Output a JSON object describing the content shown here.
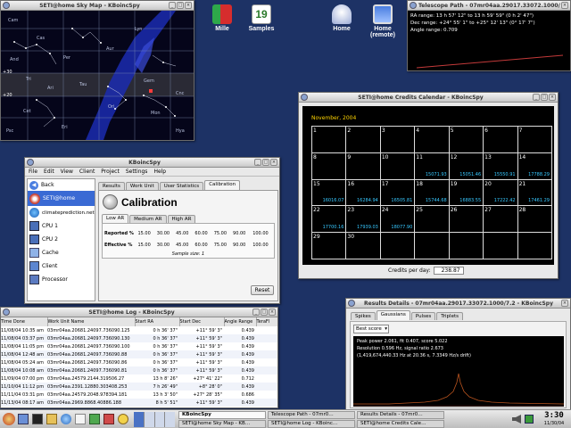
{
  "desktop_icons": [
    {
      "label": "Mille",
      "icon": "seti-flag-icon"
    },
    {
      "label": "Samples",
      "icon": "calendar-icon"
    },
    {
      "label": "Home",
      "icon": "home-dome-icon"
    },
    {
      "label": "Home\n(remote)",
      "icon": "monitor-icon"
    }
  ],
  "sky_map": {
    "title": "SETI@home Sky Map - KBoincSpy",
    "constellations": [
      "Cam",
      "Cas",
      "And",
      "Per",
      "Aur",
      "Lyn",
      "Tri",
      "Ari",
      "Tau",
      "Gem",
      "Ori",
      "Mon",
      "Cet",
      "Eri",
      "Hya",
      "Psc",
      "Cnc"
    ],
    "axis_labels": [
      "+30",
      "+20"
    ]
  },
  "telescope_path": {
    "title": "Telescope Path - 07mr04aa.29017.33072.1000/7.2…",
    "ra_range": "RA range: 13 h 57' 12\" to 13 h 59' 59\" (0 h 2' 47\")",
    "dec_range": "Dec range: +24° 55' 1\" to +25° 12' 13\" (0° 17' 7\")",
    "angle_range": "Angle range: 0.709"
  },
  "credits_calendar": {
    "title": "SETI@home Credits Calendar - KBoincSpy",
    "month": "November, 2004",
    "cells": [
      {
        "day": "1",
        "value": ""
      },
      {
        "day": "2",
        "value": ""
      },
      {
        "day": "3",
        "value": ""
      },
      {
        "day": "4",
        "value": ""
      },
      {
        "day": "5",
        "value": ""
      },
      {
        "day": "6",
        "value": ""
      },
      {
        "day": "7",
        "value": ""
      },
      {
        "day": "8",
        "value": ""
      },
      {
        "day": "9",
        "value": ""
      },
      {
        "day": "10",
        "value": ""
      },
      {
        "day": "11",
        "value": "15071.93"
      },
      {
        "day": "12",
        "value": "15051.46"
      },
      {
        "day": "13",
        "value": "15550.91"
      },
      {
        "day": "14",
        "value": "17788.29"
      },
      {
        "day": "15",
        "value": "16016.07"
      },
      {
        "day": "16",
        "value": "16284.94"
      },
      {
        "day": "17",
        "value": "16505.81"
      },
      {
        "day": "18",
        "value": "15744.68"
      },
      {
        "day": "19",
        "value": "16883.55"
      },
      {
        "day": "20",
        "value": "17222.42"
      },
      {
        "day": "21",
        "value": "17461.29"
      },
      {
        "day": "22",
        "value": "17700.16"
      },
      {
        "day": "23",
        "value": "17939.03"
      },
      {
        "day": "24",
        "value": "18077.90"
      },
      {
        "day": "25",
        "value": ""
      },
      {
        "day": "26",
        "value": ""
      },
      {
        "day": "27",
        "value": ""
      },
      {
        "day": "28",
        "value": ""
      },
      {
        "day": "29",
        "value": ""
      },
      {
        "day": "30",
        "value": ""
      },
      {
        "day": "",
        "value": ""
      },
      {
        "day": "",
        "value": ""
      },
      {
        "day": "",
        "value": ""
      },
      {
        "day": "",
        "value": ""
      },
      {
        "day": "",
        "value": ""
      }
    ],
    "credits_label": "Credits per day:",
    "credits_value": "238.87"
  },
  "kboincspy": {
    "title": "KBoincSpy",
    "menu": [
      "File",
      "Edit",
      "View",
      "Client",
      "Project",
      "Settings",
      "Help"
    ],
    "sidebar": [
      {
        "label": "Back",
        "icon": "back-arrow-icon"
      },
      {
        "label": "SETI@home",
        "icon": "seti-icon"
      },
      {
        "label": "climateprediction.net",
        "icon": "globe-icon"
      },
      {
        "label": "CPU 1",
        "icon": "cpu-icon"
      },
      {
        "label": "CPU 2",
        "icon": "cpu-icon"
      },
      {
        "label": "Cache",
        "icon": "cache-icon"
      },
      {
        "label": "Client",
        "icon": "client-icon"
      },
      {
        "label": "Processor",
        "icon": "processor-icon"
      }
    ],
    "tabs": [
      "Results",
      "Work Unit",
      "User Statistics",
      "Calibration"
    ],
    "heading": "Calibration",
    "sub_tabs": [
      "Low AR",
      "Medium AR",
      "High AR"
    ],
    "rows": [
      {
        "label": "Reported %",
        "values": [
          "15.00",
          "30.00",
          "45.00",
          "60.00",
          "75.00",
          "90.00",
          "100.00"
        ]
      },
      {
        "label": "Effective %",
        "values": [
          "15.00",
          "30.00",
          "45.00",
          "60.00",
          "75.00",
          "90.00",
          "100.00"
        ]
      }
    ],
    "sample_size": "Sample size:  1",
    "reset_label": "Reset"
  },
  "work_log": {
    "title": "SETI@home Log - KBoincSpy",
    "headers": [
      "Time Done",
      "Work Unit Name",
      "Start RA",
      "Start Dec",
      "Angle Range",
      "TeraFl"
    ],
    "rows": [
      [
        "11/08/04 10:35 am",
        "03mr04aa.20681.24097.736090.125",
        "0 h 36' 37\"",
        "+11° 59' 3\"",
        "0.439",
        ""
      ],
      [
        "11/08/04 03:37 pm",
        "03mr04aa.20681.24097.736090.130",
        "0 h 36' 37\"",
        "+11° 59' 3\"",
        "0.439",
        ""
      ],
      [
        "11/08/04 11:05 pm",
        "03mr04aa.20681.24097.736090.100",
        "0 h 36' 37\"",
        "+11° 59' 3\"",
        "0.439",
        ""
      ],
      [
        "11/08/04 12:48 am",
        "03mr04aa.20681.24097.736090.88",
        "0 h 36' 37\"",
        "+11° 59' 3\"",
        "0.439",
        ""
      ],
      [
        "11/08/04 05:24 am",
        "03mr04aa.20681.24097.736090.86",
        "0 h 36' 37\"",
        "+11° 59' 3\"",
        "0.439",
        ""
      ],
      [
        "11/08/04 10:08 am",
        "03mr04aa.20681.24097.736090.81",
        "0 h 36' 37\"",
        "+11° 59' 3\"",
        "0.439",
        ""
      ],
      [
        "11/09/04 07:00 pm",
        "03mr04aa.24579.2144.319506.27",
        "13 h 8' 26\"",
        "+27° 41' 22\"",
        "0.712",
        ""
      ],
      [
        "11/10/04 11:12 pm",
        "03mr04aa.2391.12880.303408.253",
        "7 h 26' 49\"",
        "+8° 28' 0\"",
        "0.439",
        ""
      ],
      [
        "11/11/04 03:31 pm",
        "03mr04aa.24579.2048.978394.181",
        "13 h 3' 50\"",
        "+27° 28' 35\"",
        "0.686",
        ""
      ],
      [
        "11/13/04 08:17 am",
        "03mr04aa.2969.8868.40886.188",
        "8 h 5' 51\"",
        "+11° 59' 3\"",
        "0.439",
        ""
      ]
    ]
  },
  "results_details": {
    "title": "Results Details - 07mr04aa.29017.33072.1000/7.2 - KBoincSpy",
    "tabs": [
      "Spikes",
      "Gaussians",
      "Pulses",
      "Triplets"
    ],
    "select_value": "Best score",
    "info_lines": [
      "Peak power 2.061, fit 0.407, score 5.022",
      "Resolution 0.596 Hz, signal ratio 2.673",
      "(1,419,674,440.33 Hz at 20.36 s, 7.3349 Hz/s drift)"
    ]
  },
  "taskbar": {
    "tasks": [
      {
        "label": "KBoincSpy",
        "active": true
      },
      {
        "label": "Telescope Path - 07mr0…",
        "active": false
      },
      {
        "label": "Results Details - 07mr0…",
        "active": false
      },
      {
        "label": "SETI@home Sky Map - KB…",
        "active": false
      },
      {
        "label": "SETI@home Log - KBoinc…",
        "active": false
      },
      {
        "label": "SETI@home Credits Cale…",
        "active": false
      }
    ],
    "clock": "3:30",
    "date": "11/30/04"
  },
  "colors": {
    "desktop": "#1d3265",
    "calendar_bg": "#000000",
    "calendar_value": "#37c8ff",
    "calendar_title": "#ffd400",
    "telescope_text": "#ffffff",
    "gaussian_line": "#b8531e",
    "selection": "#3a6ad4"
  }
}
